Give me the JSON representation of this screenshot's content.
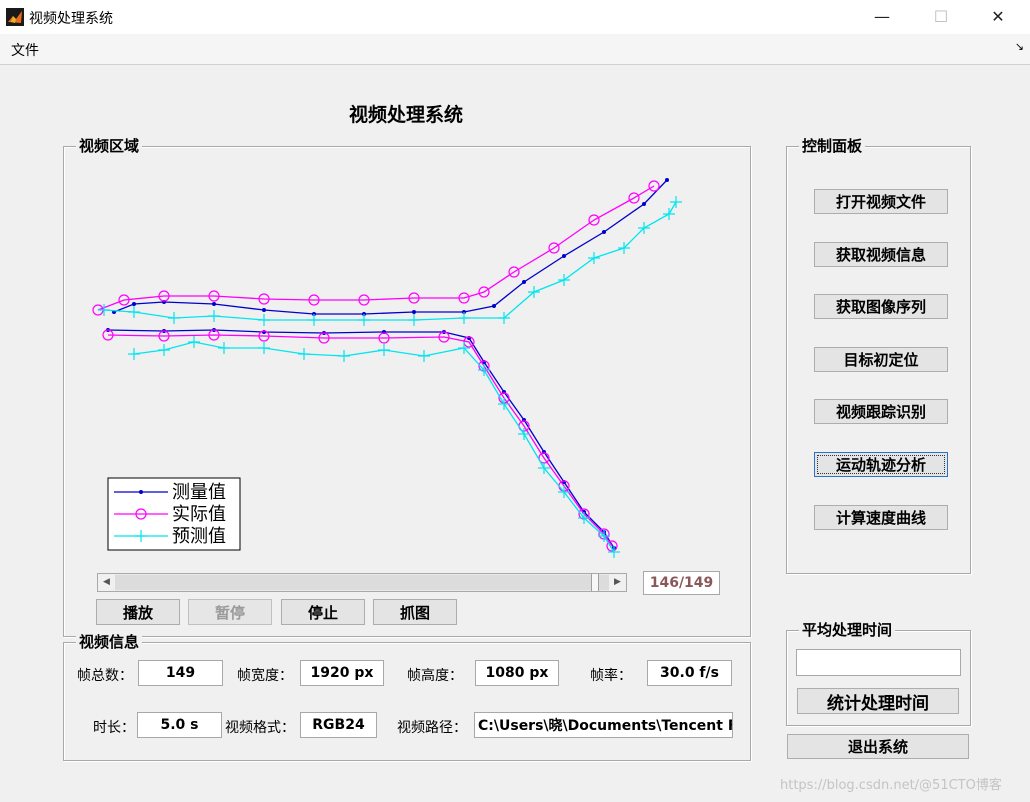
{
  "window": {
    "title": "视频处理系统",
    "controls": {
      "minimize": "—",
      "maximize": "☐",
      "close": "✕"
    }
  },
  "menu": {
    "file": "文件",
    "overflow_arrow": "↘"
  },
  "main_title": "视频处理系统",
  "video_area": {
    "title": "视频区域",
    "legend": [
      "测量值",
      "实际值",
      "预测值"
    ],
    "colors": {
      "measured": "#0000cc",
      "actual": "#ff00ff",
      "predicted": "#00e5ee"
    }
  },
  "playback": {
    "frame_counter": "146/149",
    "progress": 0.98,
    "buttons": {
      "play": "播放",
      "pause": "暂停",
      "stop": "停止",
      "capture": "抓图"
    }
  },
  "control_panel": {
    "title": "控制面板",
    "buttons": [
      "打开视频文件",
      "获取视频信息",
      "获取图像序列",
      "目标初定位",
      "视频跟踪识别",
      "运动轨迹分析",
      "计算速度曲线"
    ]
  },
  "video_info": {
    "title": "视频信息",
    "total_frames_label": "帧总数：",
    "total_frames": "149",
    "width_label": "帧宽度：",
    "width": "1920 px",
    "height_label": "帧高度：",
    "height": "1080 px",
    "fps_label": "帧率：",
    "fps": "30.0 f/s",
    "duration_label": "时长：",
    "duration": "5.0 s",
    "format_label": "视频格式：",
    "format": "RGB24",
    "path_label": "视频路径：",
    "path": "C:\\Users\\晓\\Documents\\Tencent File"
  },
  "avg_time": {
    "title": "平均处理时间",
    "value": "",
    "button": "统计处理时间"
  },
  "exit_button": "退出系统",
  "watermark": "https://blog.csdn.net/@51CTO博客",
  "chart_data": {
    "type": "line",
    "series": [
      {
        "name": "测量值",
        "marker": "dot",
        "color": "#0000cc",
        "points": [
          [
            0.07,
            0.19
          ],
          [
            0.08,
            0.1
          ],
          [
            0.16,
            0.07
          ],
          [
            0.25,
            0.07
          ],
          [
            0.3,
            0.1
          ],
          [
            0.38,
            0.12
          ],
          [
            0.45,
            0.11
          ],
          [
            0.52,
            0.1
          ],
          [
            0.6,
            0.1
          ],
          [
            0.68,
            0.08
          ],
          [
            0.72,
            0.15
          ],
          [
            0.78,
            0.2
          ],
          [
            0.85,
            0.29
          ],
          [
            0.92,
            0.4
          ],
          [
            1.0,
            0.55
          ],
          [
            1.06,
            0.65
          ],
          [
            1.1,
            0.75
          ]
        ]
      },
      {
        "name": "实际值",
        "marker": "circle",
        "color": "#ff00ff",
        "points": [
          [
            0.08,
            0.1
          ],
          [
            0.1,
            0.14
          ],
          [
            0.14,
            0.2
          ],
          [
            0.18,
            0.22
          ],
          [
            0.3,
            0.19
          ],
          [
            0.38,
            0.18
          ],
          [
            0.46,
            0.18
          ],
          [
            0.54,
            0.18
          ],
          [
            0.6,
            0.22
          ],
          [
            0.68,
            0.28
          ],
          [
            0.72,
            0.35
          ],
          [
            0.78,
            0.42
          ],
          [
            0.84,
            0.5
          ],
          [
            0.9,
            0.59
          ],
          [
            0.96,
            0.68
          ],
          [
            1.02,
            0.76
          ],
          [
            1.06,
            0.82
          ]
        ]
      },
      {
        "name": "预测值",
        "marker": "plus",
        "color": "#00e5ee",
        "points": [
          [
            0.1,
            0.05
          ],
          [
            0.12,
            0.1
          ],
          [
            0.16,
            0.02
          ],
          [
            0.2,
            0.08
          ],
          [
            0.25,
            0.01
          ],
          [
            0.3,
            0.05
          ],
          [
            0.35,
            0.08
          ],
          [
            0.42,
            0.06
          ],
          [
            0.5,
            0.1
          ],
          [
            0.55,
            0.08
          ],
          [
            0.65,
            0.09
          ],
          [
            0.7,
            0.1
          ],
          [
            0.75,
            0.18
          ],
          [
            0.82,
            0.28
          ],
          [
            0.9,
            0.4
          ],
          [
            0.98,
            0.5
          ],
          [
            1.04,
            0.6
          ],
          [
            1.1,
            0.7
          ]
        ]
      }
    ]
  }
}
